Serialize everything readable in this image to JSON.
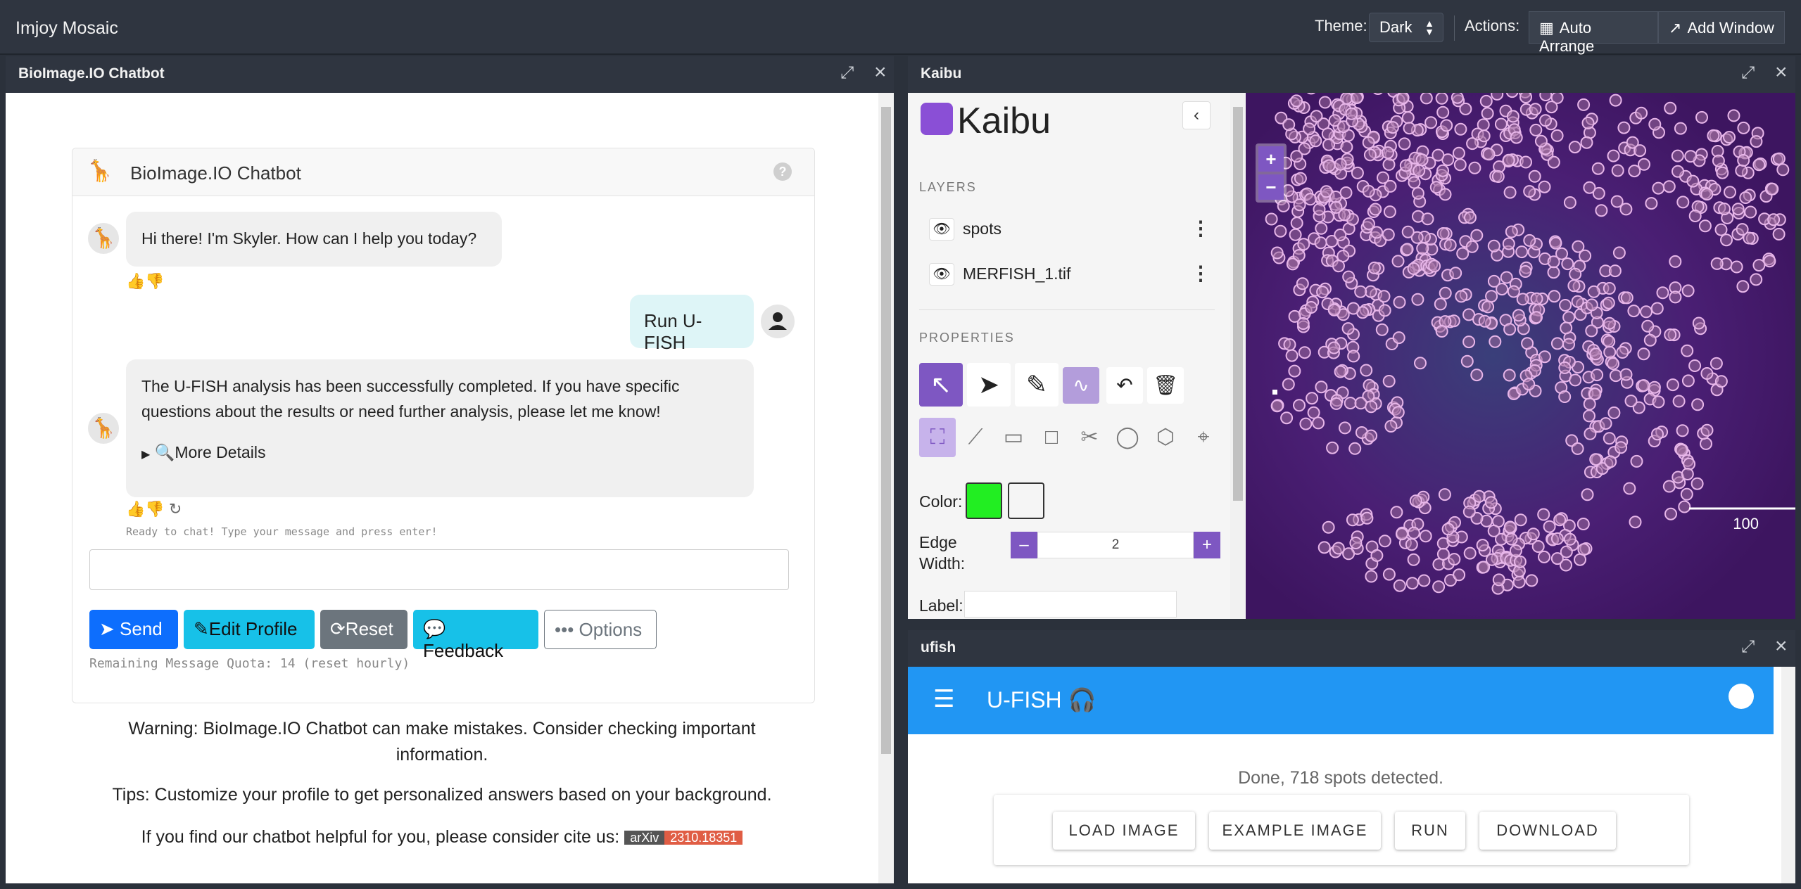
{
  "app": {
    "title": "Imjoy Mosaic"
  },
  "toolbar": {
    "theme_label": "Theme:",
    "theme_value": "Dark",
    "actions_label": "Actions:",
    "auto_arrange": "Auto Arrange",
    "add_window": "Add Window"
  },
  "chatbot_window": {
    "title": "BioImage.IO Chatbot",
    "card_title": "BioImage.IO Chatbot",
    "messages": {
      "greeting": "Hi there! I'm Skyler. How can I help you today?",
      "user": "Run U-FISH",
      "reply_line1": "The U-FISH analysis has been successfully completed. If you have specific",
      "reply_line2": "questions about the results or need further analysis, please let me know!",
      "more_details": "More Details"
    },
    "status": "Ready to chat! Type your message and press enter!",
    "input_placeholder": "",
    "buttons": {
      "send": "Send",
      "edit_profile": "Edit Profile",
      "reset": "Reset",
      "feedback": "Feedback",
      "options": "Options"
    },
    "quota": "Remaining Message Quota: 14 (reset hourly)",
    "warning_line1": "Warning: BioImage.IO Chatbot can make mistakes. Consider checking important",
    "warning_line2": "information.",
    "tips": "Tips: Customize your profile to get personalized answers based on your background.",
    "cite": "If you find our chatbot helpful for you, please consider cite us:",
    "badge_left": "arXiv",
    "badge_right": "2310.18351"
  },
  "kaibu_window": {
    "title": "Kaibu",
    "logo_text": "Kaibu",
    "layers_heading": "LAYERS",
    "layers": [
      "spots",
      "MERFISH_1.tif"
    ],
    "properties_heading": "PROPERTIES",
    "color_label": "Color:",
    "color_fill": "#22ee22",
    "color_stroke": "#f5f5f5",
    "edge_width_label_1": "Edge",
    "edge_width_label_2": "Width:",
    "edge_width_value": "2",
    "label_label": "Label:",
    "scale_bar": "100",
    "accent": "#7e57c2"
  },
  "ufish_window": {
    "title": "ufish",
    "app_title": "U-FISH",
    "status": "Done, 718 spots detected.",
    "buttons": [
      "LOAD IMAGE",
      "EXAMPLE IMAGE",
      "RUN",
      "DOWNLOAD"
    ]
  }
}
